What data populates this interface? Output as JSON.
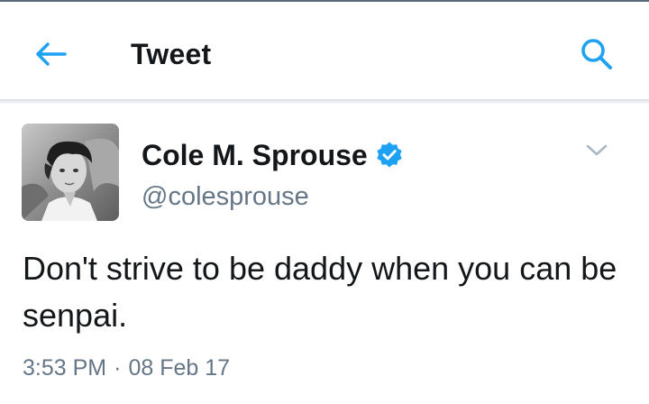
{
  "app": {
    "accent_color": "#1da1f2",
    "text_color": "#14171a",
    "secondary_text_color": "#657786"
  },
  "header": {
    "title": "Tweet",
    "back_icon": "arrow-left-icon",
    "search_icon": "search-icon"
  },
  "tweet": {
    "author_name": "Cole M. Sprouse",
    "verified": true,
    "verified_icon": "verified-badge-icon",
    "handle": "@colesprouse",
    "menu_icon": "chevron-down-icon",
    "text": "Don't strive to be daddy when you can be senpai.",
    "time": "3:53 PM",
    "separator": "·",
    "date": "08 Feb 17"
  }
}
